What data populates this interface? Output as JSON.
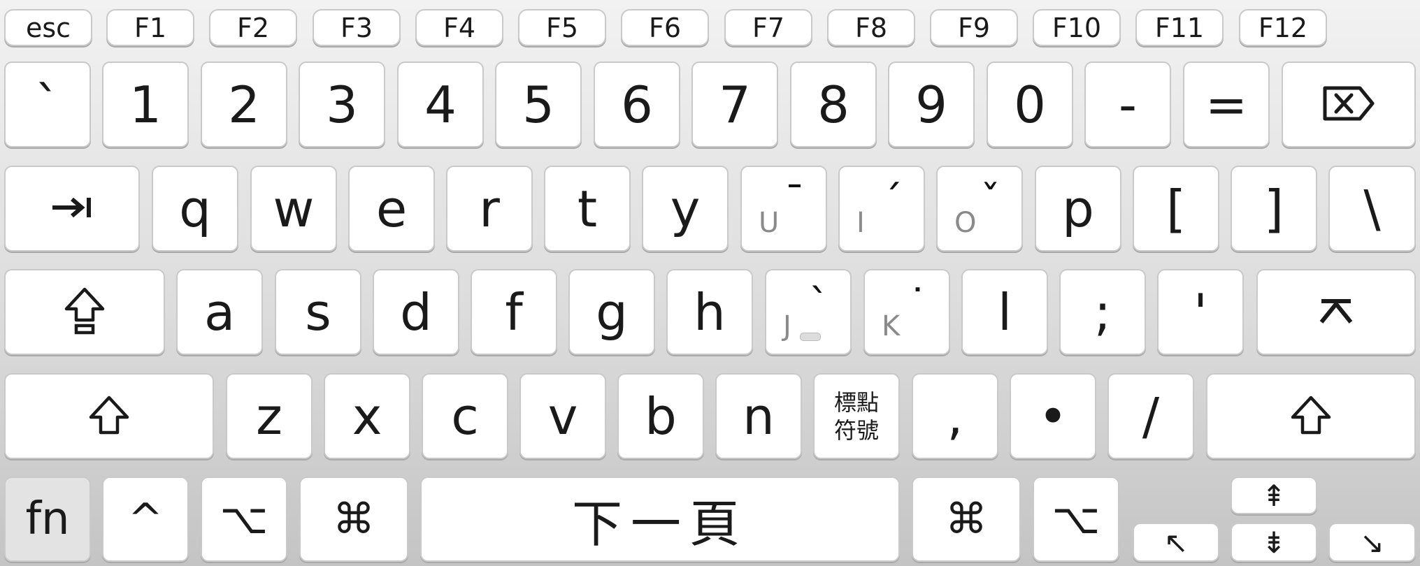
{
  "function_row": [
    "esc",
    "F1",
    "F2",
    "F3",
    "F4",
    "F5",
    "F6",
    "F7",
    "F8",
    "F9",
    "F10",
    "F11",
    "F12"
  ],
  "number_row": {
    "keys": [
      "`",
      "1",
      "2",
      "3",
      "4",
      "5",
      "6",
      "7",
      "8",
      "9",
      "0",
      "-",
      "="
    ],
    "delete_icon": "delete-icon"
  },
  "top_row": {
    "tab_icon": "tab-icon",
    "keys": [
      "q",
      "w",
      "e",
      "r",
      "t",
      "y"
    ],
    "zhuyin_keys": [
      {
        "sub": "U",
        "tone": "ˉ"
      },
      {
        "sub": "I",
        "tone": "ˊ"
      },
      {
        "sub": "O",
        "tone": "ˇ"
      }
    ],
    "keys_right": [
      "p",
      "[",
      "]",
      "\\"
    ]
  },
  "home_row": {
    "caps_icon": "caps-lock-icon",
    "keys": [
      "a",
      "s",
      "d",
      "f",
      "g",
      "h"
    ],
    "zhuyin_keys": [
      {
        "sub": "J",
        "tone": "ˋ"
      },
      {
        "sub": "K",
        "tone": "˙"
      }
    ],
    "keys_right": [
      "l",
      ";",
      "'"
    ],
    "return_icon": "return-icon"
  },
  "bottom_row": {
    "shift_icon": "shift-icon",
    "keys": [
      "z",
      "x",
      "c",
      "v",
      "b",
      "n"
    ],
    "punct_key": [
      "標點",
      "符號"
    ],
    "keys_right": [
      ",",
      "•",
      "/"
    ]
  },
  "modifier_row": {
    "fn": "fn",
    "control": "^",
    "option": "⌥",
    "command": "⌘",
    "space": "下一頁",
    "command_right": "⌘",
    "option_right": "⌥",
    "arrows": {
      "up": "⇞",
      "down": "⇟",
      "left": "↖",
      "right": "↘"
    }
  }
}
